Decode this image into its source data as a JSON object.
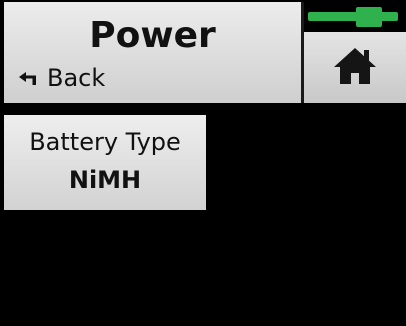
{
  "header": {
    "title": "Power",
    "back_label": "Back",
    "back_icon": "back-arrow-icon",
    "home_icon": "home-icon"
  },
  "status": {
    "battery_icon": "battery-icon",
    "battery_color": "#2fb24d"
  },
  "settings": {
    "battery_type": {
      "label": "Battery Type",
      "value": "NiMH"
    }
  }
}
